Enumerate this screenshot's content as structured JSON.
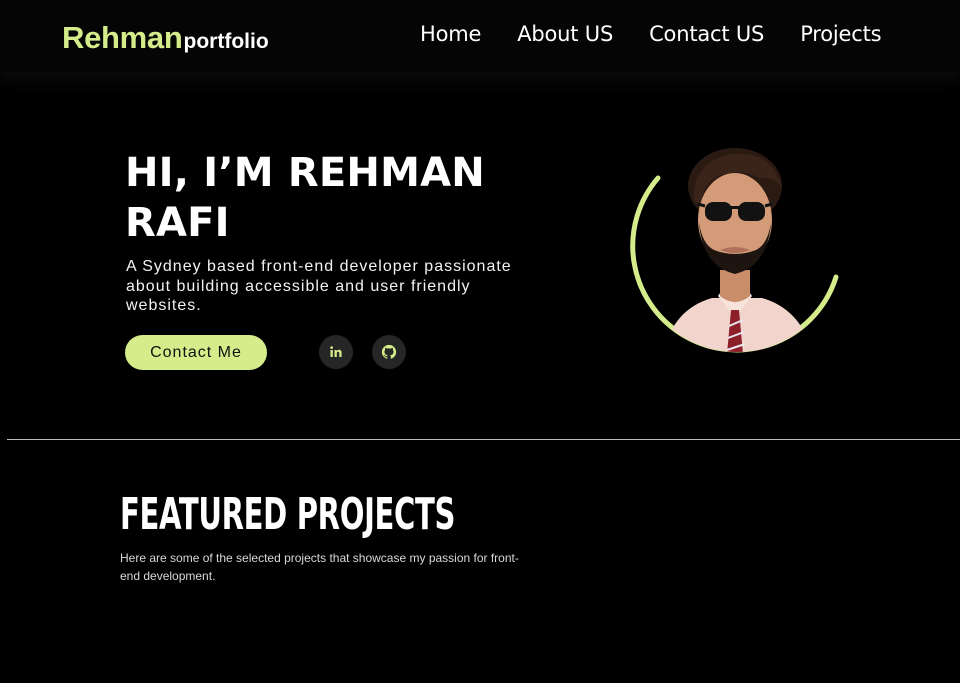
{
  "header": {
    "logo_main": "Rehman",
    "logo_sub": "portfolio",
    "nav": [
      "Home",
      "About US",
      "Contact US",
      "Projects"
    ]
  },
  "hero": {
    "title": "HI, I’M REHMAN RAFI",
    "subtitle": "A Sydney based front-end developer passionate about building accessible and user friendly websites.",
    "cta_label": "Contact Me",
    "social": [
      {
        "icon": "linkedin-icon",
        "label": "in"
      },
      {
        "icon": "github-icon"
      }
    ]
  },
  "featured": {
    "title": "FEATURED PROJECTS",
    "subtitle": "Here are some of the selected projects that showcase my passion for front-end development."
  },
  "colors": {
    "accent": "#d4ec8a",
    "background": "#000000",
    "social_bg": "#262626"
  }
}
